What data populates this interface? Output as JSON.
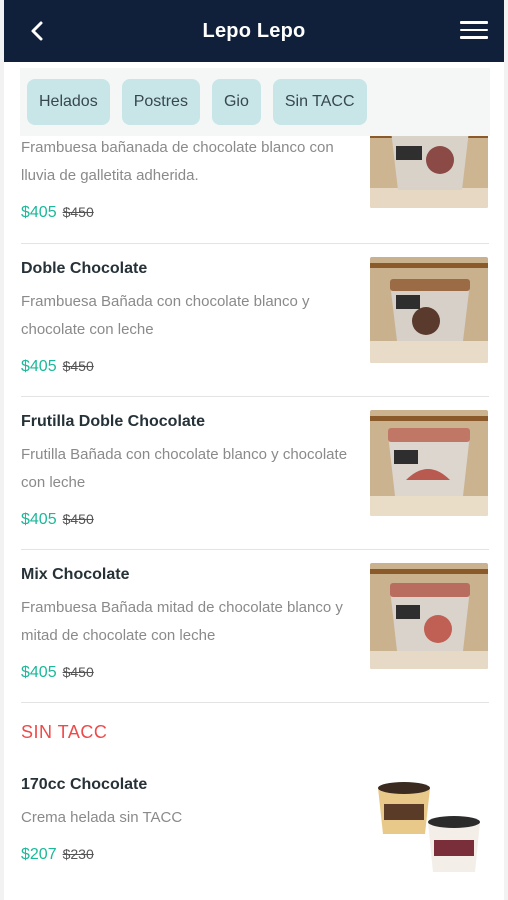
{
  "header": {
    "title": "Lepo Lepo",
    "back_icon": "chevron-left-icon",
    "menu_icon": "hamburger-menu-icon",
    "background": "#10203a"
  },
  "categories": [
    {
      "label": "Helados"
    },
    {
      "label": "Postres"
    },
    {
      "label": "Gio"
    },
    {
      "label": "Sin TACC"
    }
  ],
  "products": [
    {
      "name": "",
      "description": "Frambuesa bañanada de chocolate blanco con lluvia de galletita adherida.",
      "price": "$405",
      "old_price": "$450"
    },
    {
      "name": "Doble Chocolate",
      "description": "Frambuesa Bañada con chocolate blanco y chocolate con leche",
      "price": "$405",
      "old_price": "$450"
    },
    {
      "name": "Frutilla Doble Chocolate",
      "description": "Frutilla Bañada con chocolate blanco y chocolate con leche",
      "price": "$405",
      "old_price": "$450"
    },
    {
      "name": "Mix Chocolate",
      "description": "Frambuesa Bañada mitad de chocolate blanco y mitad de chocolate con leche",
      "price": "$405",
      "old_price": "$450"
    }
  ],
  "section_sin_tacc": {
    "title": "SIN TACC",
    "products": [
      {
        "name": "170cc Chocolate",
        "description": "Crema helada sin TACC",
        "price": "$207",
        "old_price": "$230"
      }
    ]
  },
  "colors": {
    "accent_price": "#1bb89a",
    "section_title": "#ef4a4a",
    "chip_bg": "#c8e6e8"
  }
}
